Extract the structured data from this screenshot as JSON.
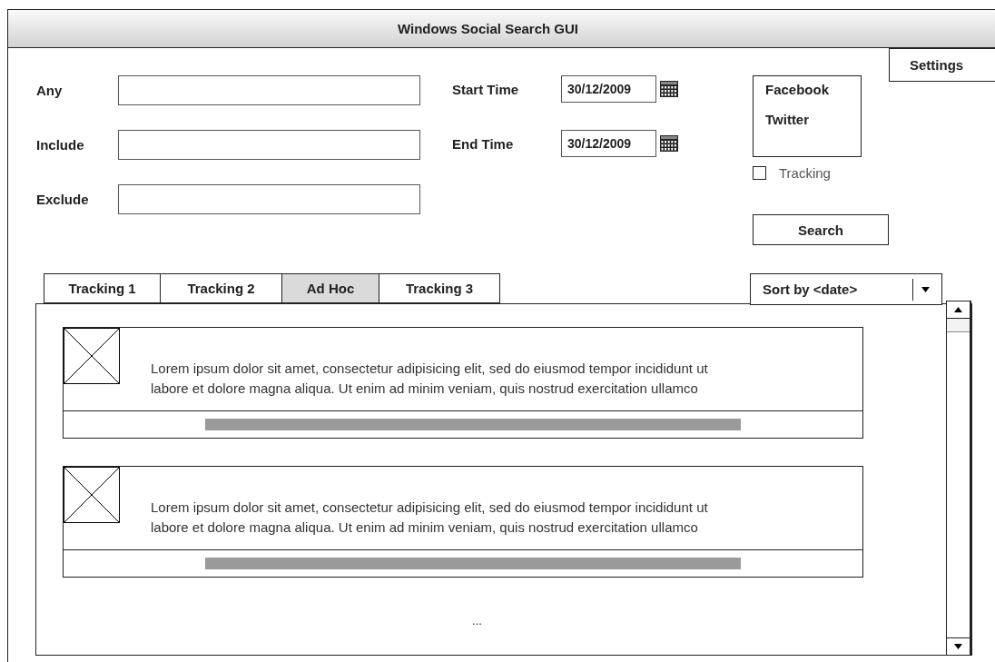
{
  "window": {
    "title": "Windows Social Search GUI"
  },
  "settings_button": {
    "label": "Settings"
  },
  "query_fields": [
    {
      "label": "Any"
    },
    {
      "label": "Include"
    },
    {
      "label": "Exclude"
    }
  ],
  "time_fields": [
    {
      "label": "Start Time",
      "value": "30/12/2009"
    },
    {
      "label": "End Time",
      "value": "30/12/2009"
    }
  ],
  "sources": [
    {
      "label": "Facebook"
    },
    {
      "label": "Twitter"
    }
  ],
  "tracking": {
    "label": "Tracking",
    "checked": false
  },
  "search_button": {
    "label": "Search"
  },
  "tabs": [
    {
      "label": "Tracking 1",
      "selected": false
    },
    {
      "label": "Tracking 2",
      "selected": false
    },
    {
      "label": "Ad Hoc",
      "selected": true
    },
    {
      "label": "Tracking 3",
      "selected": false
    }
  ],
  "sort": {
    "value": "Sort by <date>"
  },
  "results": [
    {
      "lines": [
        "Lorem ipsum dolor sit amet, consectetur adipisicing elit, sed do eiusmod tempor incididunt ut",
        "labore et dolore magna aliqua. Ut enim ad minim veniam, quis nostrud exercitation ullamco"
      ]
    },
    {
      "lines": [
        "Lorem ipsum dolor sit amet, consectetur adipisicing elit, sed do eiusmod tempor incididunt ut",
        "labore et dolore magna aliqua. Ut enim ad minim veniam, quis nostrud exercitation ullamco"
      ]
    }
  ],
  "more": "..."
}
